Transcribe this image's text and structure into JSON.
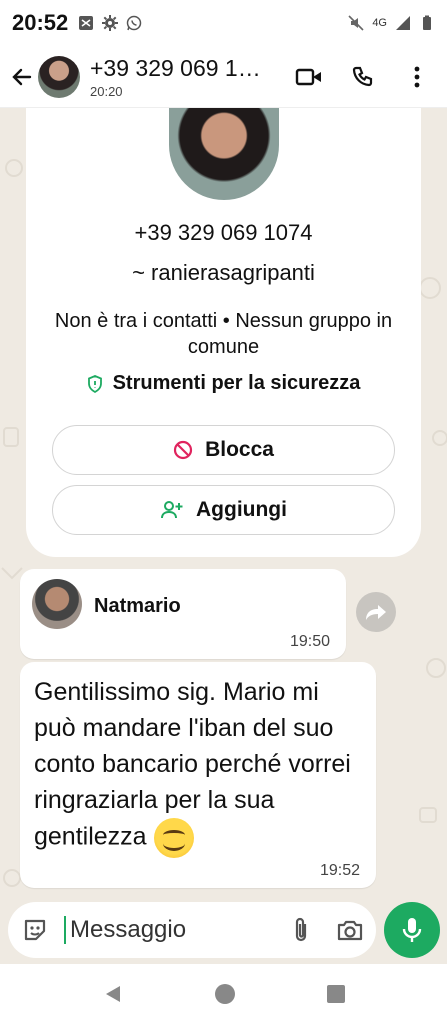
{
  "status_bar": {
    "time": "20:52",
    "network_label": "4G",
    "icons": [
      "message-icon",
      "gear-icon",
      "whatsapp-icon",
      "mute-icon",
      "signal-icon",
      "battery-icon"
    ]
  },
  "header": {
    "title": "+39 329 069 1…",
    "subtitle": "20:20",
    "icons": [
      "back-arrow-icon",
      "video-call-icon",
      "phone-icon",
      "more-vert-icon"
    ]
  },
  "profile": {
    "phone": "+39 329 069 1074",
    "username": "~ ranierasagripanti",
    "info": "Non è tra i contatti • Nessun gruppo in comune",
    "security": "Strumenti per la sicurezza",
    "block_label": "Blocca",
    "add_label": "Aggiungi"
  },
  "messages": [
    {
      "type": "contact",
      "name": "Natmario",
      "time": "19:50"
    },
    {
      "type": "text",
      "text": "Gentilissimo sig. Mario mi può mandare l'iban del suo conto bancario perché vorrei ringraziarla per la sua gentilezza",
      "emoji": "😊",
      "time": "19:52"
    }
  ],
  "composer": {
    "placeholder": "Messaggio"
  },
  "colors": {
    "accent": "#1daa61",
    "danger": "#e0245e",
    "chat_bg": "#efeae2"
  }
}
